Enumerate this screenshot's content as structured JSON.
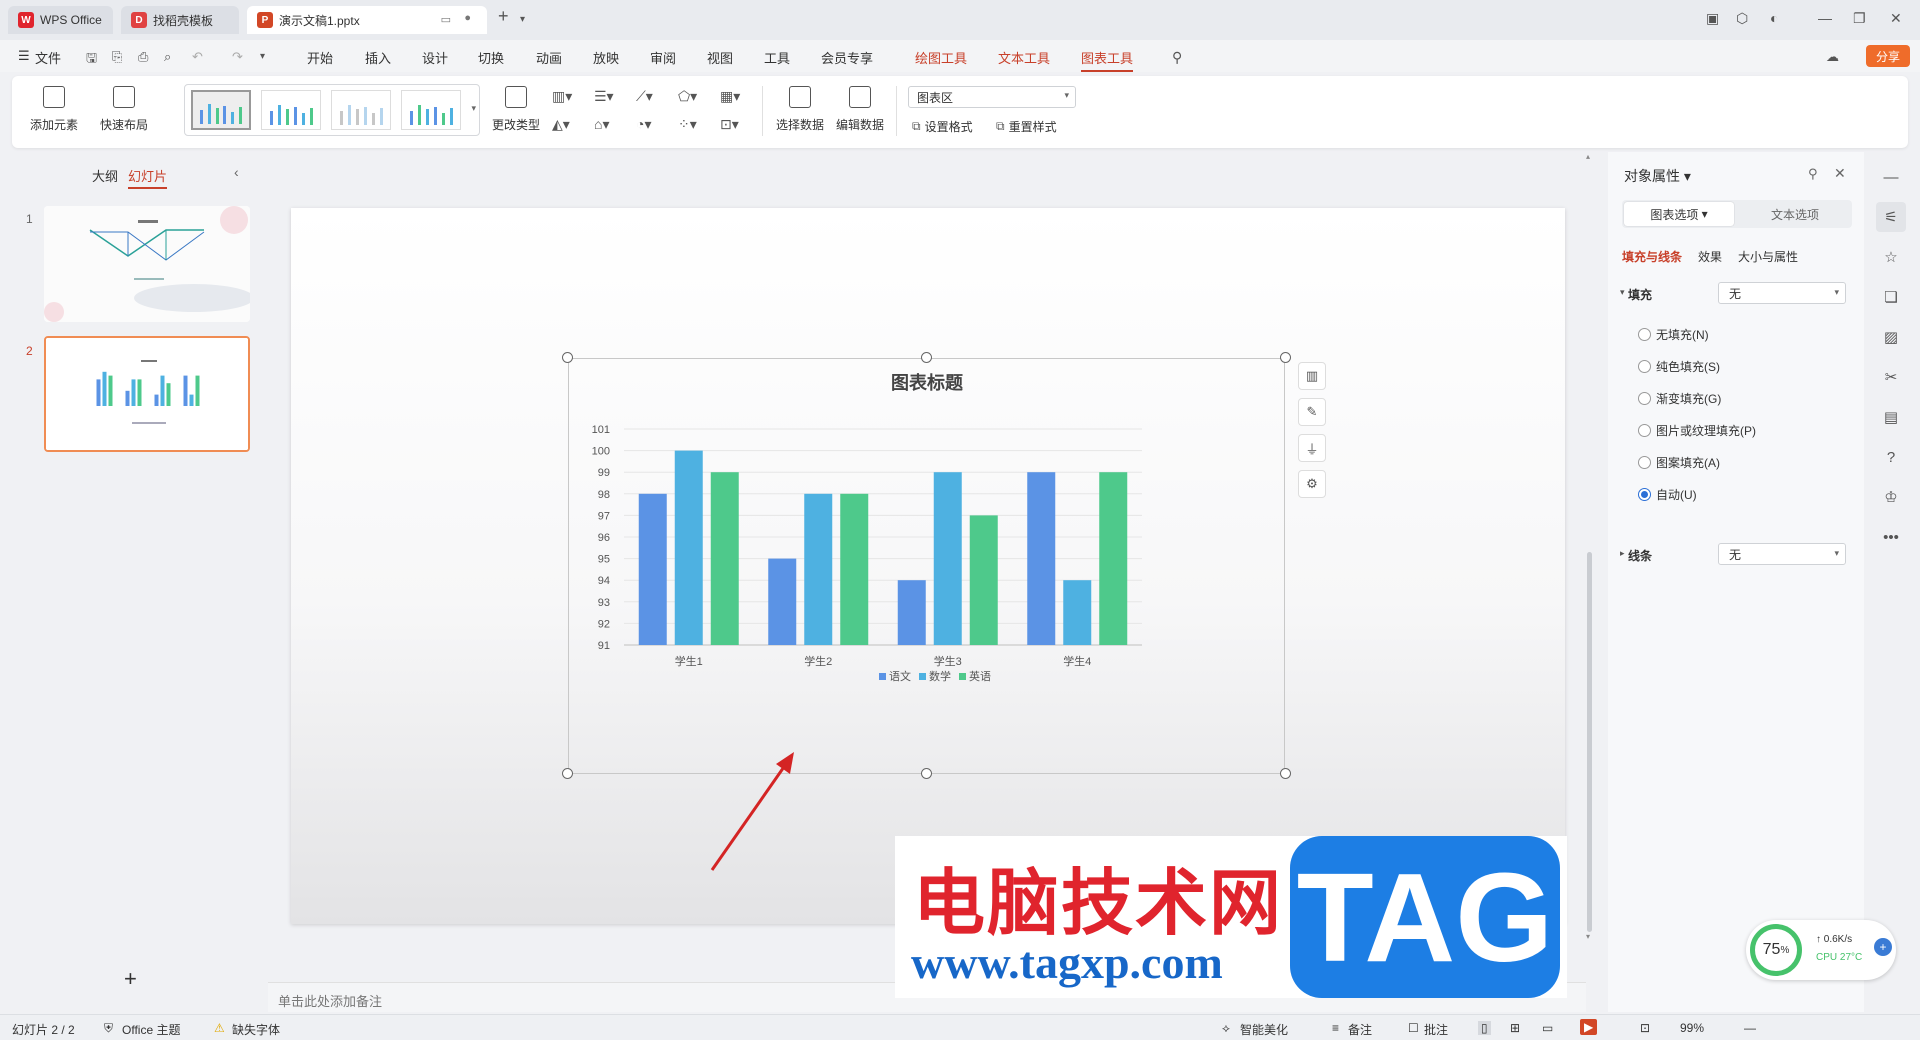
{
  "titlebar": {
    "tabs": [
      {
        "label": "WPS Office",
        "icon": "wps-logo-icon",
        "color": "#e0242d"
      },
      {
        "label": "找稻壳模板",
        "icon": "docer-icon",
        "color": "#e04242"
      },
      {
        "label": "演示文稿1.pptx",
        "icon": "ppt-icon",
        "color": "#d24726"
      }
    ],
    "new_tab": "+"
  },
  "menubar": {
    "file": "文件",
    "items": [
      "开始",
      "插入",
      "设计",
      "切换",
      "动画",
      "放映",
      "审阅",
      "视图",
      "工具",
      "会员专享"
    ],
    "context_items": [
      "绘图工具",
      "文本工具",
      "图表工具"
    ],
    "active_context": "图表工具",
    "share": "分享"
  },
  "ribbon": {
    "add_element": "添加元素",
    "quick_layout": "快速布局",
    "change_type": "更改类型",
    "select_data": "选择数据",
    "edit_data": "编辑数据",
    "chart_area_select": "图表区",
    "set_format": "设置格式",
    "reset_style": "重置样式"
  },
  "leftpane": {
    "tab_outline": "大纲",
    "tab_slides": "幻灯片",
    "slides": [
      "1",
      "2"
    ],
    "selected_slide": "2",
    "add_slide": "+"
  },
  "notes_placeholder": "单击此处添加备注",
  "chart_data": {
    "type": "bar",
    "title": "图表标题",
    "categories": [
      "学生1",
      "学生2",
      "学生3",
      "学生4"
    ],
    "series": [
      {
        "name": "语文",
        "values": [
          98,
          95,
          94,
          99
        ],
        "color": "#5b93e5"
      },
      {
        "name": "数学",
        "values": [
          100,
          98,
          99,
          94
        ],
        "color": "#4eb1e1"
      },
      {
        "name": "英语",
        "values": [
          99,
          98,
          97,
          99
        ],
        "color": "#4ec98b"
      }
    ],
    "ylim": [
      91,
      101
    ],
    "yticks": [
      91,
      92,
      93,
      94,
      95,
      96,
      97,
      98,
      99,
      100,
      101
    ],
    "grid": true,
    "legend": "bottom"
  },
  "rightpane": {
    "title": "对象属性",
    "seg_chart": "图表选项",
    "seg_text": "文本选项",
    "subtabs": [
      "填充与线条",
      "效果",
      "大小与属性"
    ],
    "fill_label": "填充",
    "fill_value": "无",
    "fill_options": [
      "无填充(N)",
      "纯色填充(S)",
      "渐变填充(G)",
      "图片或纹理填充(P)",
      "图案填充(A)",
      "自动(U)"
    ],
    "selected_fill": "自动(U)",
    "line_label": "线条",
    "line_value": "无"
  },
  "statusbar": {
    "slide_info": "幻灯片 2 / 2",
    "theme": "Office 主题",
    "missing_font": "缺失字体",
    "smart_beautify": "智能美化",
    "notes": "备注",
    "comments": "批注",
    "zoom": "99%"
  },
  "perf": {
    "percent": "75",
    "percent_unit": "%",
    "net": "0.6K/s",
    "cpu": "CPU 27°C"
  },
  "watermark": {
    "cn": "电脑技术网",
    "url": "www.tagxp.com",
    "tag": "TAG"
  }
}
